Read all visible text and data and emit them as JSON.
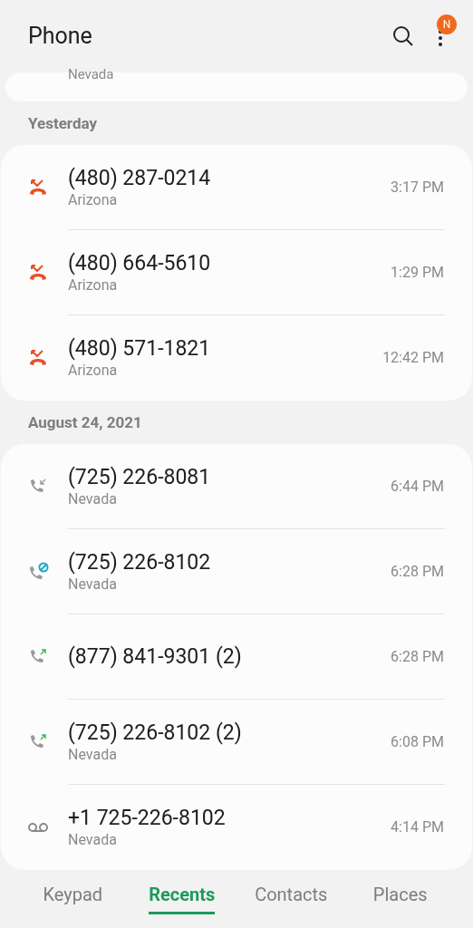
{
  "header": {
    "title": "Phone",
    "badge": "N"
  },
  "partial_entry": {
    "location": "Nevada"
  },
  "sections": [
    {
      "heading": "Yesterday",
      "calls": [
        {
          "kind": "missed",
          "number": "(480) 287-0214",
          "location": "Arizona",
          "time": "3:17 PM"
        },
        {
          "kind": "missed",
          "number": "(480) 664-5610",
          "location": "Arizona",
          "time": "1:29 PM"
        },
        {
          "kind": "missed",
          "number": "(480) 571-1821",
          "location": "Arizona",
          "time": "12:42 PM"
        }
      ]
    },
    {
      "heading": "August 24, 2021",
      "calls": [
        {
          "kind": "incoming",
          "number": "(725) 226-8081",
          "location": "Nevada",
          "time": "6:44 PM"
        },
        {
          "kind": "blocked",
          "number": "(725) 226-8102",
          "location": "Nevada",
          "time": "6:28 PM"
        },
        {
          "kind": "outgoing",
          "number": "(877) 841-9301 (2)",
          "time": "6:28 PM"
        },
        {
          "kind": "outgoing",
          "number": "(725) 226-8102 (2)",
          "location": "Nevada",
          "time": "6:08 PM"
        },
        {
          "kind": "voicemail",
          "number": "+1 725-226-8102",
          "location": "Nevada",
          "time": "4:14 PM"
        }
      ]
    }
  ],
  "tabs": [
    {
      "label": "Keypad",
      "selected": false
    },
    {
      "label": "Recents",
      "selected": true
    },
    {
      "label": "Contacts",
      "selected": false
    },
    {
      "label": "Places",
      "selected": false
    }
  ]
}
